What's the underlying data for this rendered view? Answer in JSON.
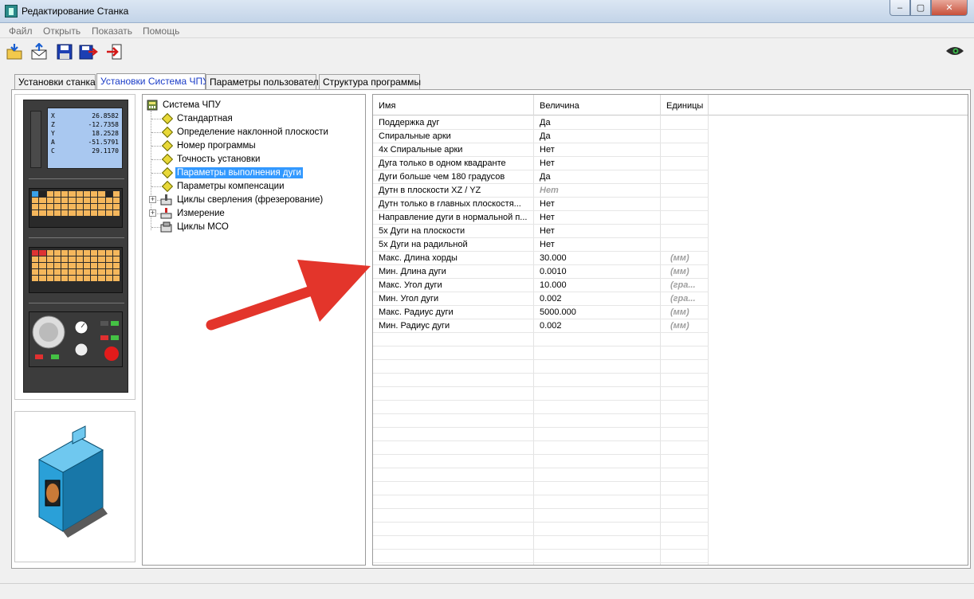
{
  "window": {
    "title": "Редактирование Станка",
    "minimize": "–",
    "maximize": "▢",
    "close": "✕"
  },
  "menu": [
    "Файл",
    "Открыть",
    "Показать",
    "Помощь"
  ],
  "toolbar": {
    "icons": [
      "open-icon",
      "mail-icon",
      "save-icon",
      "save-as-icon",
      "exit-icon"
    ],
    "eye": "eye-icon"
  },
  "tabs": [
    {
      "label": "Установки станка",
      "active": false
    },
    {
      "label": "Установки Система ЧПУ",
      "active": true
    },
    {
      "label": "Параметры пользователя",
      "active": false
    },
    {
      "label": "Структура программы",
      "active": false
    }
  ],
  "cnc_screen": [
    {
      "axis": "X",
      "value": "26.8582"
    },
    {
      "axis": "Z",
      "value": "-12.7358"
    },
    {
      "axis": "Y",
      "value": "18.2528"
    },
    {
      "axis": "A",
      "value": "-51.5791"
    },
    {
      "axis": "C",
      "value": "29.1170"
    }
  ],
  "tree": {
    "root": "Система ЧПУ",
    "items": [
      "Стандартная",
      "Определение наклонной плоскости",
      "Номер программы",
      "Точность установки",
      "Параметры выполнения дуги",
      "Параметры компенсации"
    ],
    "selected_index": 4,
    "groups": [
      "Циклы сверления (фрезерование)",
      "Измерение",
      "Циклы МСО"
    ]
  },
  "grid": {
    "columns": [
      "Имя",
      "Величина",
      "Единицы"
    ],
    "rows": [
      {
        "name": "Поддержка дуг",
        "value": "Да",
        "unit": "",
        "muted": false
      },
      {
        "name": "Спиральные арки",
        "value": "Да",
        "unit": "",
        "muted": false
      },
      {
        "name": "4х Спиральные арки",
        "value": "Нет",
        "unit": "",
        "muted": false
      },
      {
        "name": "Дуга только в одном квадранте",
        "value": "Нет",
        "unit": "",
        "muted": false
      },
      {
        "name": "Дуги больше чем 180 градусов",
        "value": "Да",
        "unit": "",
        "muted": false
      },
      {
        "name": "Дутн в  плоскости XZ / YZ",
        "value": "Нет",
        "unit": "",
        "muted": true
      },
      {
        "name": "Дутн только в  главных плоскостя...",
        "value": "Нет",
        "unit": "",
        "muted": false
      },
      {
        "name": "Направление дуги в нормальной п...",
        "value": "Нет",
        "unit": "",
        "muted": false
      },
      {
        "name": "5х Дуги на плоскости",
        "value": "Нет",
        "unit": "",
        "muted": false
      },
      {
        "name": "5х Дуги на радильной",
        "value": "Нет",
        "unit": "",
        "muted": false
      },
      {
        "name": "Макс. Длина хорды",
        "value": "30.000",
        "unit": "(мм)",
        "muted": false
      },
      {
        "name": "Мин. Длина дуги",
        "value": "0.0010",
        "unit": "(мм)",
        "muted": false
      },
      {
        "name": "Макс. Угол дуги",
        "value": "10.000",
        "unit": "(гра...",
        "muted": false
      },
      {
        "name": "Мин. Угол дуги",
        "value": "0.002",
        "unit": "(гра...",
        "muted": false
      },
      {
        "name": "Макс. Радиус дуги",
        "value": "5000.000",
        "unit": "(мм)",
        "muted": false
      },
      {
        "name": "Мин. Радиус дуги",
        "value": "0.002",
        "unit": "(мм)",
        "muted": false
      }
    ]
  },
  "annotation": {
    "arrow_color": "#e3352b"
  }
}
